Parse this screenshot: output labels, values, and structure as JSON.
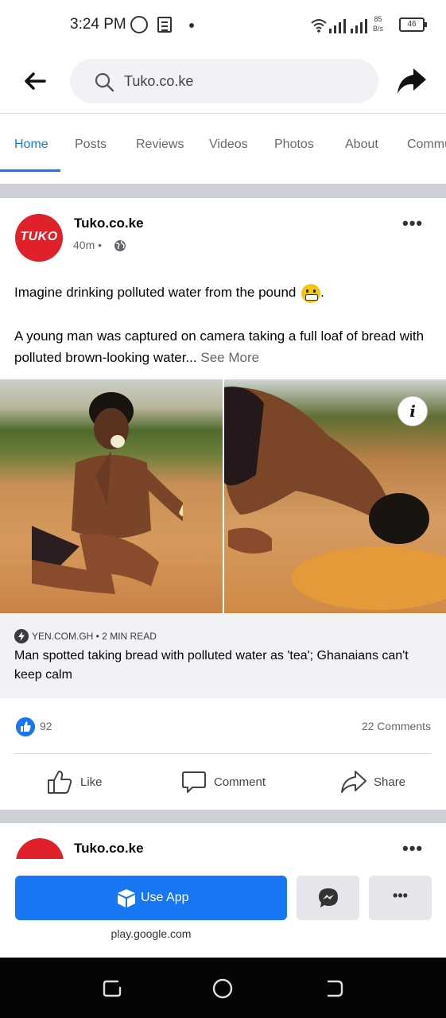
{
  "status_bar": {
    "time": "3:24 PM",
    "speed_value": "85",
    "speed_unit": "B/s",
    "battery": "46"
  },
  "top_bar": {
    "search_text": "Tuko.co.ke"
  },
  "tabs": [
    {
      "label": "Home",
      "active": true
    },
    {
      "label": "Posts"
    },
    {
      "label": "Reviews"
    },
    {
      "label": "Videos"
    },
    {
      "label": "Photos"
    },
    {
      "label": "About"
    },
    {
      "label": "Community"
    }
  ],
  "post": {
    "page_name": "Tuko.co.ke",
    "avatar_text": "TUKO",
    "time": "40m",
    "text_line1": "Imagine drinking polluted water from the pound",
    "text_line2": "A young man was captured on camera taking a full loaf of bread with polluted brown-looking water...",
    "see_more": "See More",
    "link": {
      "source": "YEN.COM.GH • 2 MIN READ",
      "title": "Man spotted taking bread with polluted water as 'tea'; Ghanaians can't keep calm"
    },
    "reactions": "92",
    "comments": "22 Comments",
    "actions": {
      "like": "Like",
      "comment": "Comment",
      "share": "Share"
    }
  },
  "next_post": {
    "page_name": "Tuko.co.ke"
  },
  "app_bar": {
    "use_app": "Use App",
    "more": "•••",
    "play_link": "play.google.com"
  },
  "colors": {
    "accent": "#1877f2",
    "brand_red": "#e0202a"
  }
}
